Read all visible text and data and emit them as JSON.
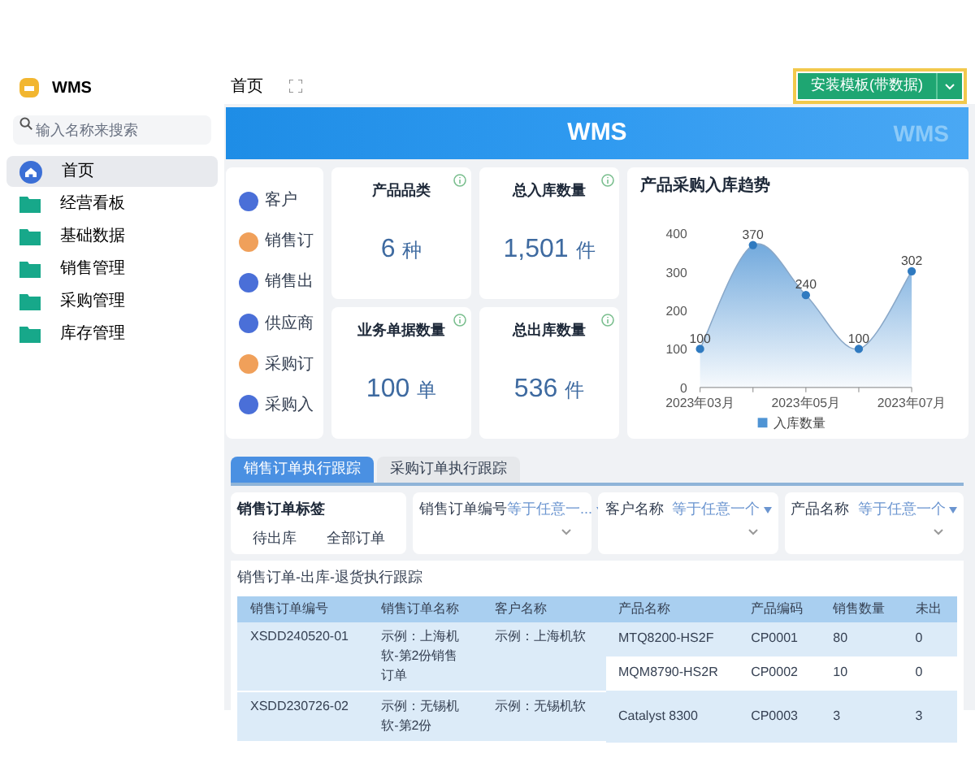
{
  "sidebar": {
    "logo": "WMS",
    "search": {
      "placeholder": "输入名称来搜索"
    },
    "items": [
      {
        "label": "首页",
        "kind": "home",
        "selected": true
      },
      {
        "label": "经营看板",
        "kind": "folder",
        "selected": false
      },
      {
        "label": "基础数据",
        "kind": "folder",
        "selected": false
      },
      {
        "label": "销售管理",
        "kind": "folder",
        "selected": false
      },
      {
        "label": "采购管理",
        "kind": "folder",
        "selected": false
      },
      {
        "label": "库存管理",
        "kind": "folder",
        "selected": false
      }
    ]
  },
  "topbar": {
    "page_title": "首页",
    "install_button": "安装模板(带数据)"
  },
  "banner": {
    "title": "WMS",
    "mark": "WMS"
  },
  "quick_links": [
    {
      "label": "客户",
      "color": "#4a6fd8"
    },
    {
      "label": "销售订",
      "color": "#f0a05a"
    },
    {
      "label": "销售出",
      "color": "#4a6fd8"
    },
    {
      "label": "供应商",
      "color": "#4a6fd8"
    },
    {
      "label": "采购订",
      "color": "#f0a05a"
    },
    {
      "label": "采购入",
      "color": "#4a6fd8"
    }
  ],
  "stats": [
    {
      "title": "产品品类",
      "value": "6",
      "unit": "种"
    },
    {
      "title": "总入库数量",
      "value": "1,501",
      "unit": "件"
    },
    {
      "title": "业务单据数量",
      "value": "100",
      "unit": "单"
    },
    {
      "title": "总出库数量",
      "value": "536",
      "unit": "件"
    }
  ],
  "trend": {
    "chart_data": {
      "type": "area",
      "title": "产品采购入库趋势",
      "categories": [
        "2023年03月",
        null,
        "2023年05月",
        null,
        "2023年07月"
      ],
      "series": [
        {
          "name": "入库数量",
          "color": "#4f94d4",
          "values": [
            100,
            370,
            240,
            100,
            302
          ]
        }
      ],
      "yticks": [
        0,
        100,
        200,
        300,
        400
      ],
      "ylim": [
        0,
        400
      ],
      "data_labels": true
    }
  },
  "tabs": [
    {
      "label": "销售订单执行跟踪",
      "selected": true
    },
    {
      "label": "采购订单执行跟踪",
      "selected": false
    }
  ],
  "filters": {
    "tag_label": "销售订单标签",
    "tag_buttons": [
      "待出库",
      "全部订单"
    ],
    "fields": [
      {
        "label": "销售订单编号",
        "operator": "等于任意一..."
      },
      {
        "label": "客户名称",
        "operator": "等于任意一个"
      },
      {
        "label": "产品名称",
        "operator": "等于任意一个"
      }
    ]
  },
  "table": {
    "title": "销售订单-出库-退货执行跟踪",
    "columns": [
      "销售订单编号",
      "销售订单名称",
      "客户名称",
      "产品名称",
      "产品编码",
      "销售数量",
      "未出"
    ],
    "orders": [
      {
        "number": "XSDD240520-01",
        "name": "示例：上海机软-第2份销售订单",
        "customer": "示例：上海机软",
        "items": [
          {
            "product": "MTQ8200-HS2F",
            "code": "CP0001",
            "qty": "80",
            "pending": "0"
          },
          {
            "product": "MQM8790-HS2R",
            "code": "CP0002",
            "qty": "10",
            "pending": "0"
          }
        ]
      },
      {
        "number": "XSDD230726-02",
        "name": "示例：无锡机软-第2份",
        "customer": "示例：无锡机软",
        "items": [
          {
            "product": "Catalyst 8300",
            "code": "CP0003",
            "qty": "3",
            "pending": "3"
          }
        ]
      }
    ]
  }
}
